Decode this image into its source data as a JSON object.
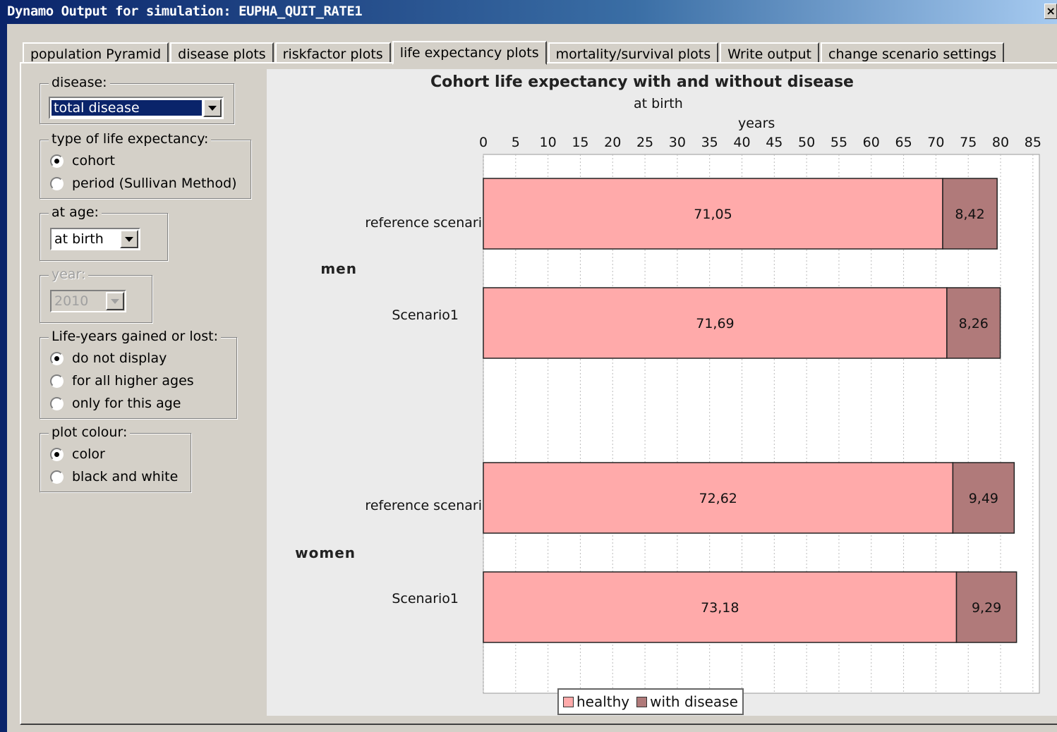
{
  "window": {
    "title": "Dynamo Output for simulation:  EUPHA_QUIT_RATE1",
    "close_label": "×"
  },
  "tabs": [
    {
      "label": "population Pyramid"
    },
    {
      "label": "disease plots"
    },
    {
      "label": "riskfactor plots"
    },
    {
      "label": "life expectancy plots",
      "active": true
    },
    {
      "label": "mortality/survival plots"
    },
    {
      "label": "Write output"
    },
    {
      "label": "change scenario settings"
    }
  ],
  "controls": {
    "disease": {
      "label": "disease:",
      "value": "total disease"
    },
    "type": {
      "label": "type of life expectancy:",
      "options": [
        "cohort",
        "period (Sullivan Method)"
      ],
      "selected": 0
    },
    "age": {
      "label": "at age:",
      "value": "at birth"
    },
    "year": {
      "label": "year:",
      "value": "2010",
      "disabled": true
    },
    "lifeyears": {
      "label": "Life-years gained or lost:",
      "options": [
        "do not display",
        "for all higher ages",
        "only for this age"
      ],
      "selected": 0
    },
    "colour": {
      "label": "plot colour:",
      "options": [
        "color",
        "black and white"
      ],
      "selected": 0
    }
  },
  "colors": {
    "healthy": "#ffaaaa",
    "disease": "#b07a7a",
    "plot_bg": "#ffffff",
    "panel_bg": "#ebebeb"
  },
  "chart_data": {
    "type": "bar",
    "orientation": "horizontal",
    "stacked": true,
    "title": "Cohort life expectancy with and without disease",
    "subtitle": "at birth",
    "xlabel": "years",
    "xlim": [
      0,
      86
    ],
    "xticks": [
      0,
      5,
      10,
      15,
      20,
      25,
      30,
      35,
      40,
      45,
      50,
      55,
      60,
      65,
      70,
      75,
      80,
      85
    ],
    "grid": true,
    "legend_position": "bottom",
    "groups": [
      {
        "name": "men",
        "categories": [
          "reference scenari",
          "Scenario1"
        ]
      },
      {
        "name": "women",
        "categories": [
          "reference scenari",
          "Scenario1"
        ]
      }
    ],
    "series": [
      {
        "name": "healthy",
        "values": [
          71.05,
          71.69,
          72.62,
          73.18
        ],
        "labels": [
          "71,05",
          "71,69",
          "72,62",
          "73,18"
        ]
      },
      {
        "name": "with disease",
        "values": [
          8.42,
          8.26,
          9.49,
          9.29
        ],
        "labels": [
          "8,42",
          "8,26",
          "9,49",
          "9,29"
        ]
      }
    ]
  }
}
